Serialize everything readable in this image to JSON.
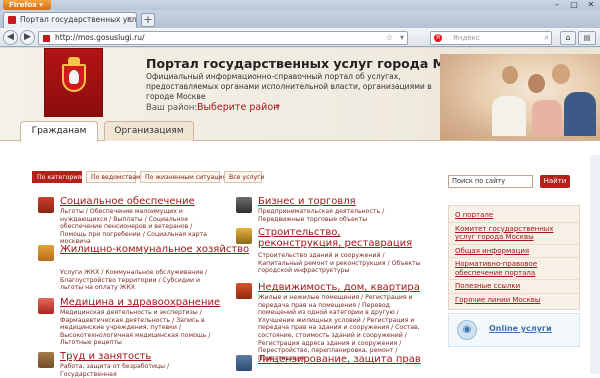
{
  "browser": {
    "app_button": "Firefox",
    "tab_title": "Портал государственных услуг города...",
    "url": "http://mos.gosuslugi.ru/",
    "search_placeholder": "Яндекс"
  },
  "site": {
    "title": "Портал государственных услуг города Москвы",
    "subtitle": "Официальный информационно-справочный портал об услугах, предоставляемых органами исполнительной власти, организациями в городе Москве",
    "district_label": "Ваш район:",
    "district_link": "Выберите район",
    "tabs": [
      "Гражданам",
      "Организациям"
    ]
  },
  "filters": [
    "По категориям",
    "По ведомствам",
    "По жизненным ситуациям",
    "Все услуги"
  ],
  "categories_left": [
    {
      "title": "Социальное обеспечение",
      "links": "Льготы / Обеспечение малоимущих и нуждающихся / Выплаты / Социальное обеспечение пенсионеров и ветеранов / Помощь при погребении / Социальная карта москвича"
    },
    {
      "title": "Жилищно-коммунальное хозяйство",
      "links": "Услуги ЖКХ / Коммунальное обслуживание / Благоустройство территории / Субсидии и льготы на оплату ЖКХ"
    },
    {
      "title": "Медицина и здравоохранение",
      "links": "Медицинская деятельность и экспертизы / Фармацевтическая деятельность / Запись в медицинские учреждения, путевки / Высокотехнологичная медицинская помощь / Льготные рецепты"
    },
    {
      "title": "Труд и занятость",
      "links": "Работа, защита от безработицы / Государственная"
    }
  ],
  "categories_right": [
    {
      "title": "Бизнес и торговля",
      "links": "Предпринимательская деятельность / Передвижные торговые объекты"
    },
    {
      "title": "Строительство, реконструкция, реставрация",
      "links": "Строительство зданий и сооружений / Капитальный ремонт и реконструкция / Объекты городской инфраструктуры"
    },
    {
      "title": "Недвижимость, дом, квартира",
      "links": "Жилые и нежилые помещения / Регистрация и передача прав на помещения / Перевод помещений из одной категории в другую / Улучшение жилищных условий / Регистрация и передача прав на здания и сооружения / Состав, состояние, стоимость зданий и сооружений / Регистрация адреса здания и сооружения / Перестройство, переплан­ировка, ремонт / Приватизация"
    },
    {
      "title": "Лицензирование, защита прав",
      "links": ""
    }
  ],
  "sidebar": {
    "search_value": "Поиск по сайту",
    "search_button": "Найти",
    "menu": [
      "О портале",
      "Комитет государственных услуг города Москвы",
      "Общая информация",
      "Нормативно-правовое обеспечение портала",
      "Полезные ссылки",
      "Горячие линии Москвы"
    ],
    "online_label": "Online услуги"
  },
  "colors": {
    "accent": "#a5161a",
    "button": "#b3211b",
    "header_bg": "#f0ebe0"
  }
}
